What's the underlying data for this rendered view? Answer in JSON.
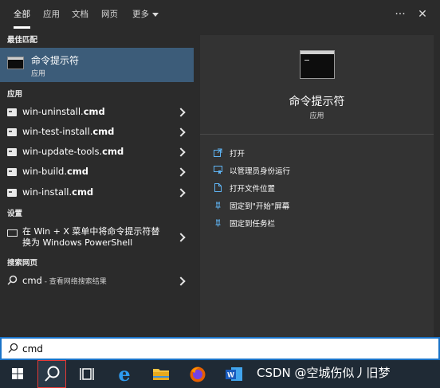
{
  "tabs": {
    "all": "全部",
    "apps": "应用",
    "docs": "文档",
    "web": "网页",
    "more": "更多",
    "ellipsis": "···",
    "close": "✕"
  },
  "left": {
    "best_match_header": "最佳匹配",
    "best_match": {
      "title": "命令提示符",
      "subtitle": "应用",
      "icon": "cmd-icon"
    },
    "apps_header": "应用",
    "apps": [
      {
        "prefix": "win-uninstall.",
        "bold": "cmd"
      },
      {
        "prefix": "win-test-install.",
        "bold": "cmd"
      },
      {
        "prefix": "win-update-tools.",
        "bold": "cmd"
      },
      {
        "prefix": "win-build.",
        "bold": "cmd"
      },
      {
        "prefix": "win-install.",
        "bold": "cmd"
      }
    ],
    "settings_header": "设置",
    "setting_item": {
      "line1": "在 Win + X 菜单中将命令提示符替",
      "line2": "换为 Windows PowerShell"
    },
    "web_header": "搜索网页",
    "web_item": {
      "query": "cmd",
      "suffix": " - 查看网络搜索结果"
    }
  },
  "detail": {
    "title": "命令提示符",
    "subtitle": "应用",
    "actions": [
      {
        "label": "打开",
        "icon": "open-icon"
      },
      {
        "label": "以管理员身份运行",
        "icon": "shield-run-icon"
      },
      {
        "label": "打开文件位置",
        "icon": "file-location-icon"
      },
      {
        "label": "固定到\"开始\"屏幕",
        "icon": "pin-start-icon"
      },
      {
        "label": "固定到任务栏",
        "icon": "pin-taskbar-icon"
      }
    ]
  },
  "search": {
    "value": "cmd",
    "placeholder": "cmd"
  },
  "taskbar": {
    "items": [
      "start-icon",
      "search-icon",
      "task-view-icon",
      "edge-icon",
      "file-explorer-icon",
      "firefox-icon",
      "word-icon"
    ],
    "watermark": "CSDN @空城伤似丿旧梦"
  },
  "colors": {
    "accent": "#3c5c79",
    "panel": "#2b2b2b",
    "detail": "#333333",
    "taskbar": "#1f2a35",
    "search_border": "#1a73c8"
  }
}
